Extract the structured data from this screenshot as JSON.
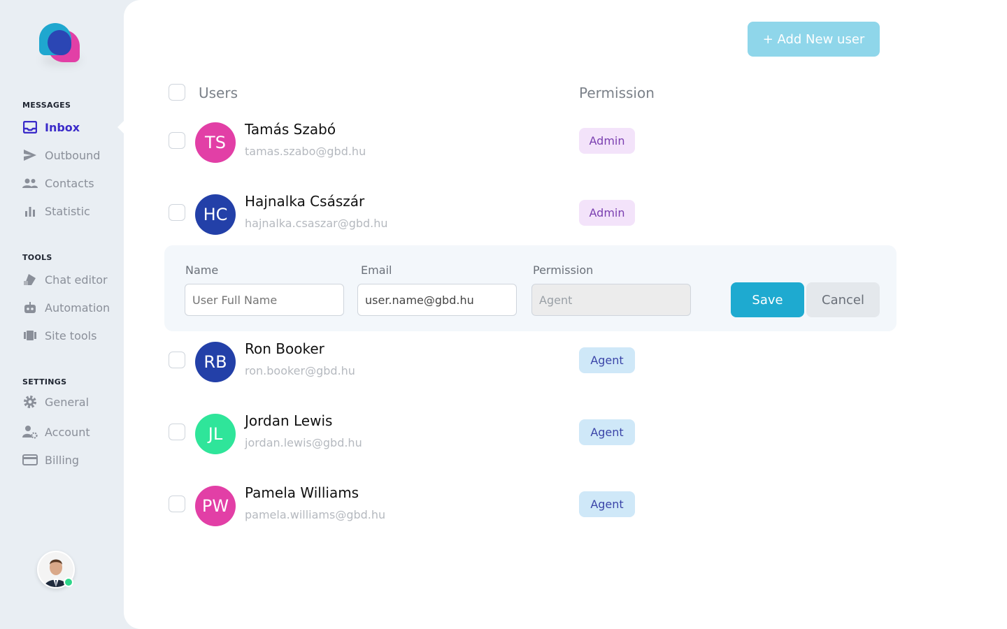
{
  "sidebar": {
    "sections": [
      {
        "title": "MESSAGES",
        "items": [
          {
            "label": "Inbox",
            "icon": "inbox-icon",
            "active": true
          },
          {
            "label": "Outbound",
            "icon": "send-icon"
          },
          {
            "label": "Contacts",
            "icon": "contacts-icon"
          },
          {
            "label": "Statistic",
            "icon": "bar-chart-icon"
          }
        ]
      },
      {
        "title": "TOOLS",
        "items": [
          {
            "label": "Chat editor",
            "icon": "chat-editor-icon"
          },
          {
            "label": "Automation",
            "icon": "robot-icon"
          },
          {
            "label": "Site tools",
            "icon": "site-tools-icon"
          }
        ]
      },
      {
        "title": "SETTINGS",
        "items": [
          {
            "label": "General",
            "icon": "gear-icon"
          },
          {
            "label": "Account",
            "icon": "account-settings-icon"
          },
          {
            "label": "Billing",
            "icon": "credit-card-icon"
          }
        ]
      }
    ]
  },
  "toolbar": {
    "add_label": "+ Add New user"
  },
  "table": {
    "headers": {
      "users": "Users",
      "permission": "Permission"
    },
    "rows": [
      {
        "initials": "TS",
        "name": "Tamás Szabó",
        "email": "tamas.szabo@gbd.hu",
        "permission": "Admin",
        "color": "#e23fa6"
      },
      {
        "initials": "HC",
        "name": "Hajnalka Császár",
        "email": "hajnalka.csaszar@gbd.hu",
        "permission": "Admin",
        "color": "#2340a8"
      },
      {
        "initials": "RB",
        "name": "Ron Booker",
        "email": "ron.booker@gbd.hu",
        "permission": "Agent",
        "color": "#2340a8"
      },
      {
        "initials": "JL",
        "name": "Jordan Lewis",
        "email": "jordan.lewis@gbd.hu",
        "permission": "Agent",
        "color": "#2fe59a"
      },
      {
        "initials": "PW",
        "name": "Pamela Williams",
        "email": "pamela.williams@gbd.hu",
        "permission": "Agent",
        "color": "#e23fa6"
      }
    ]
  },
  "form": {
    "name_label": "Name",
    "email_label": "Email",
    "permission_label": "Permission",
    "name_placeholder": "User Full Name",
    "email_value": "user.name@gbd.hu",
    "permission_value": "Agent",
    "save_label": "Save",
    "cancel_label": "Cancel"
  },
  "colors": {
    "accent": "#1eaad0",
    "active_nav": "#3b2bc9",
    "online": "#2ed58a"
  }
}
